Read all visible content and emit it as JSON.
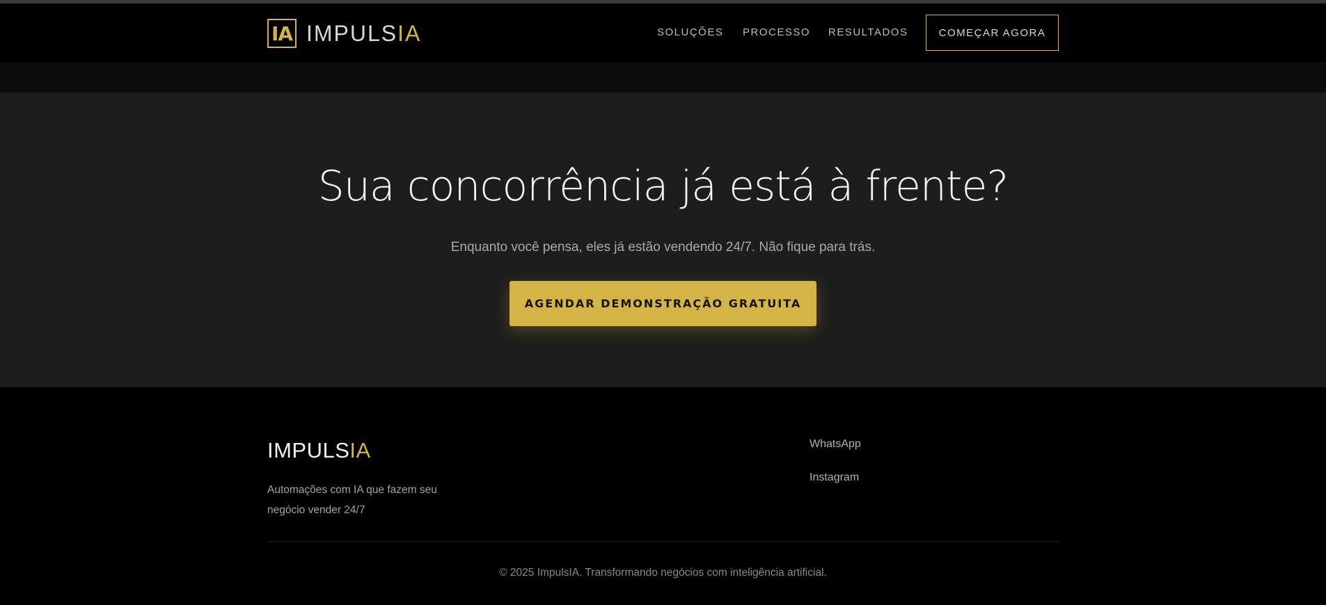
{
  "header": {
    "logo_mark": "IA",
    "logo_text_main": "IMPULS",
    "logo_text_accent": "IA",
    "nav": [
      {
        "label": "SOLUÇÕES"
      },
      {
        "label": "PROCESSO"
      },
      {
        "label": "RESULTADOS"
      }
    ],
    "cta_label": "COMEÇAR AGORA"
  },
  "hero": {
    "title": "Sua concorrência já está à frente?",
    "subtitle": "Enquanto você pensa, eles já estão vendendo 24/7. Não fique para trás.",
    "cta_label": "AGENDAR DEMONSTRAÇÃO GRATUITA"
  },
  "footer": {
    "logo_main": "IMPULS",
    "logo_accent": "IA",
    "description": "Automações com IA que fazem seu negócio vender 24/7",
    "links": [
      {
        "label": "WhatsApp"
      },
      {
        "label": "Instagram"
      }
    ],
    "copyright": "© 2025 ImpulsIA. Transformando negócios com inteligência artificial."
  },
  "colors": {
    "accent": "#d4b446",
    "background": "#000000",
    "hero_background": "#1d1d1d"
  }
}
